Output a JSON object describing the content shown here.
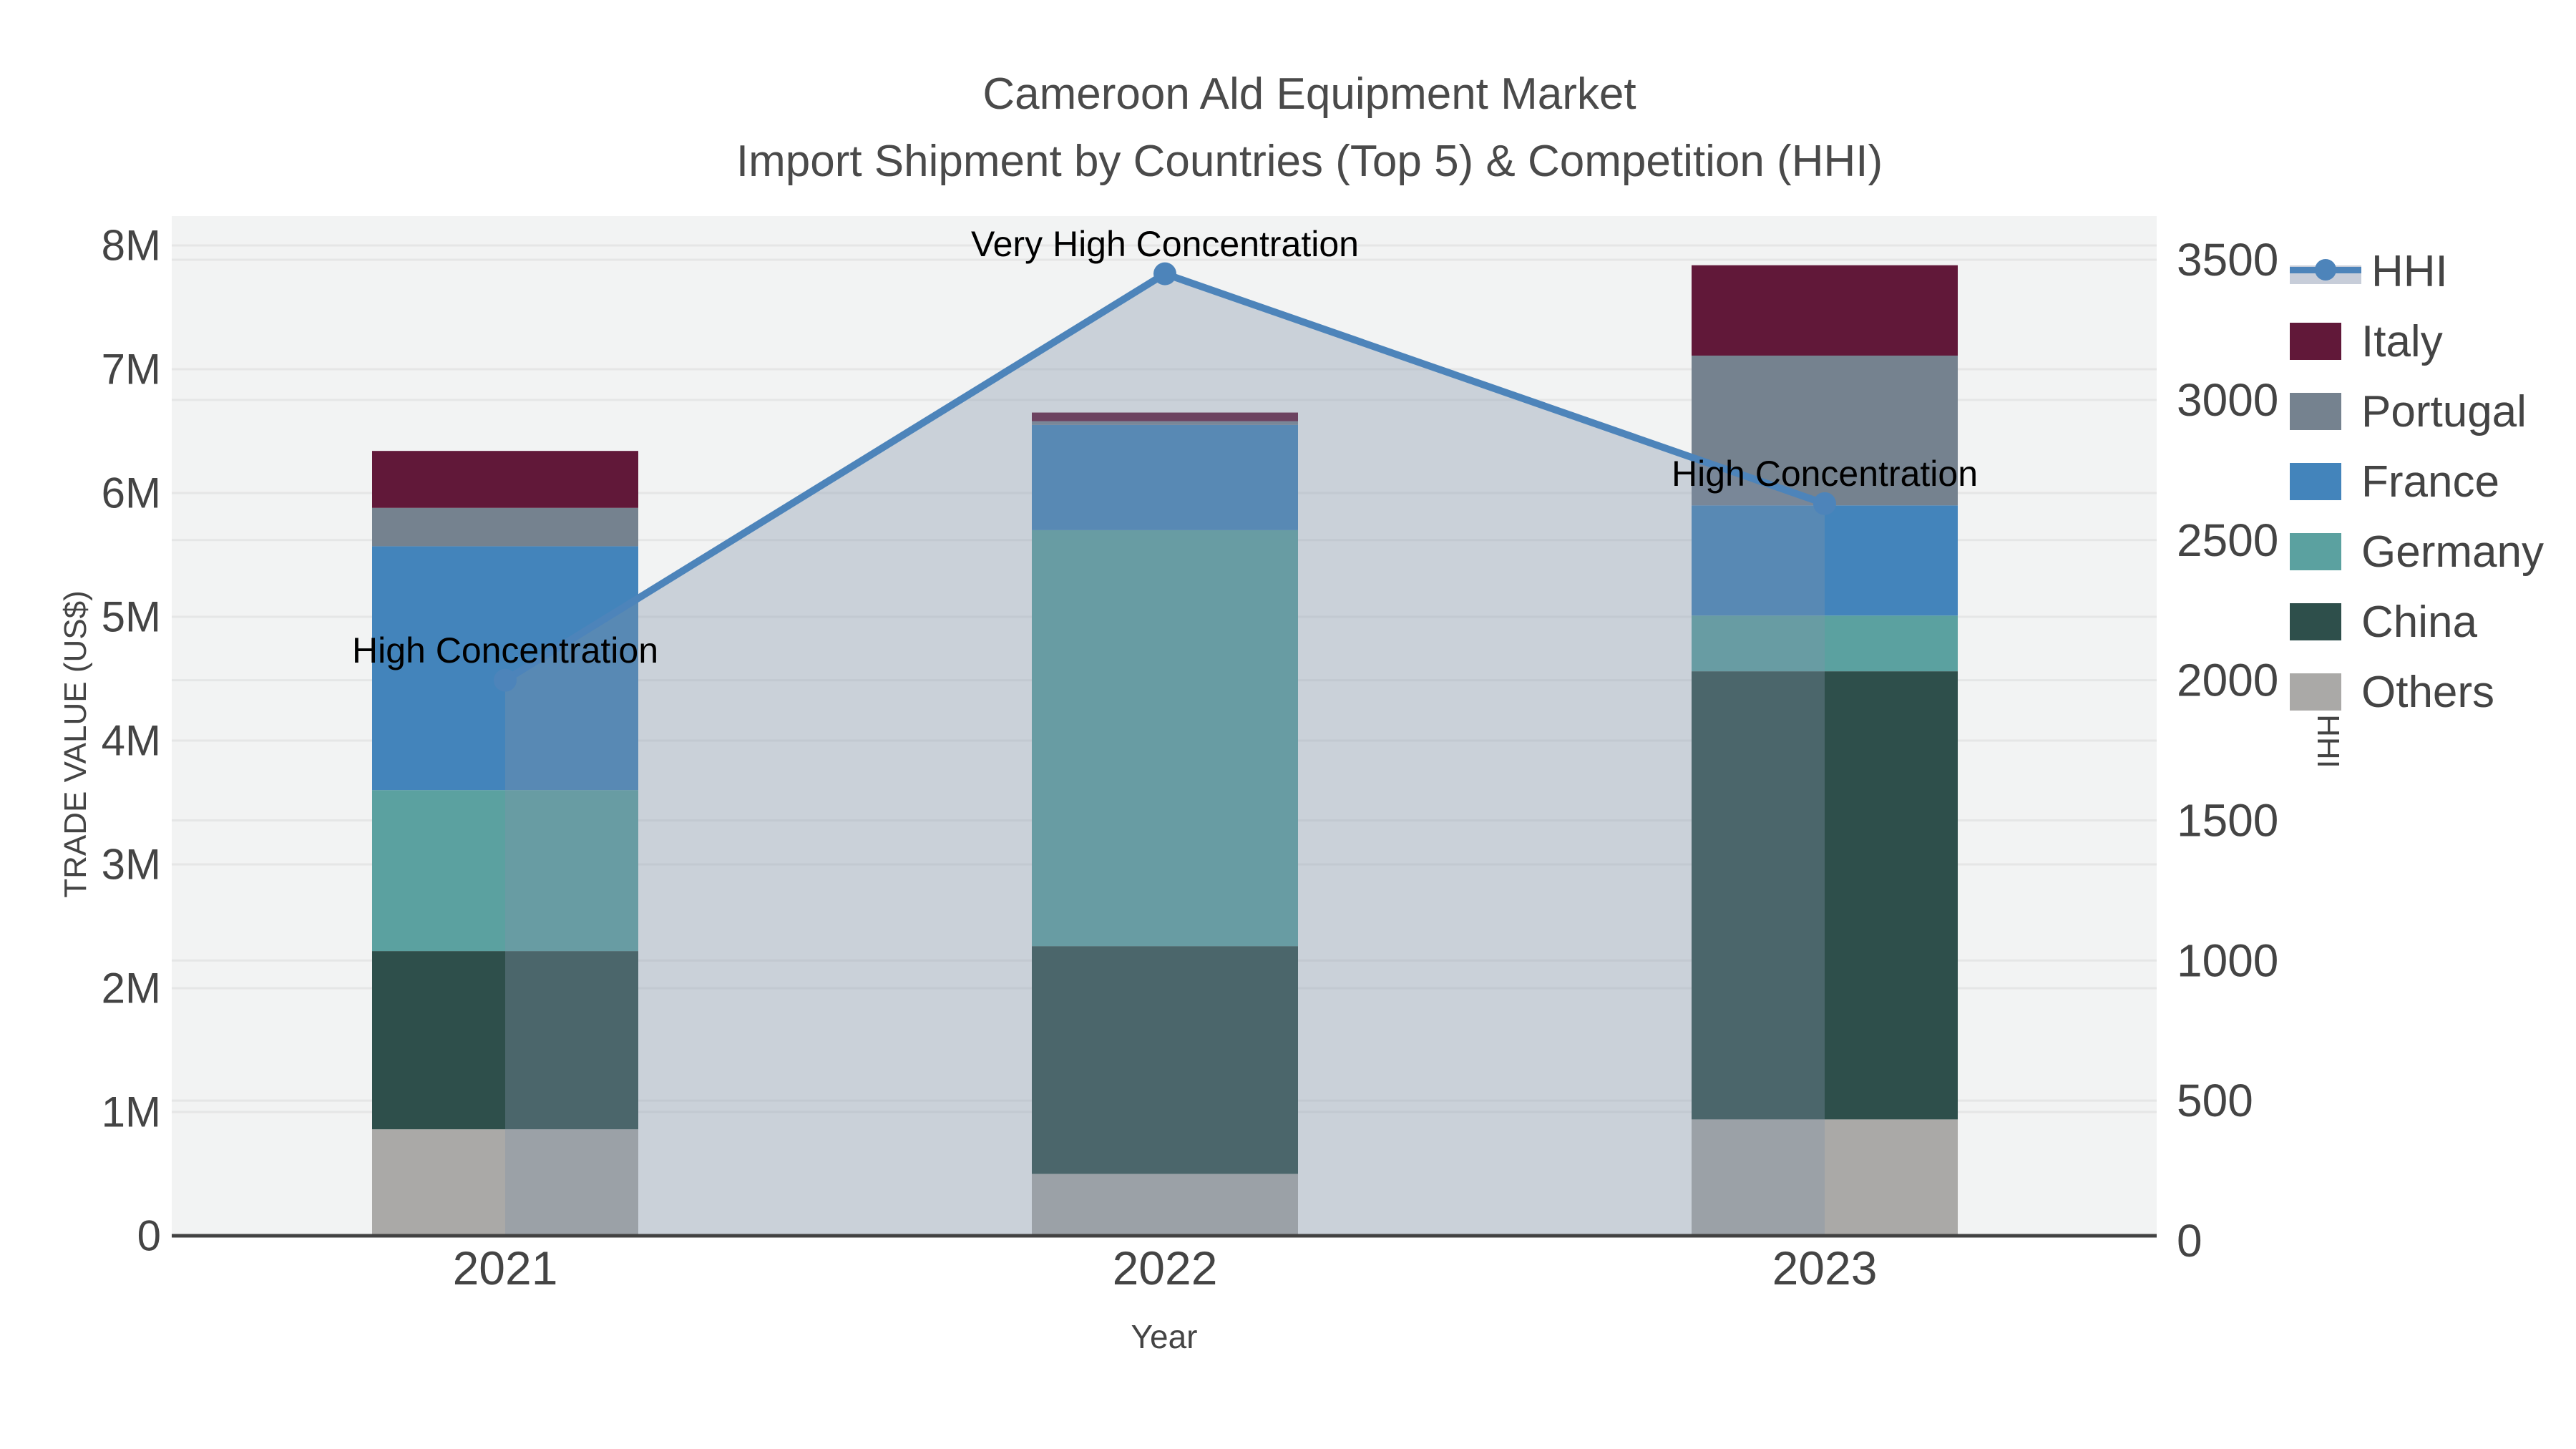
{
  "title": {
    "line1": "Cameroon Ald Equipment Market",
    "line2": "Import Shipment by Countries (Top 5) & Competition (HHI)"
  },
  "axes": {
    "left": {
      "title": "TRADE VALUE (US$)",
      "ticks": [
        "0",
        "1M",
        "2M",
        "3M",
        "4M",
        "5M",
        "6M",
        "7M",
        "8M"
      ]
    },
    "right": {
      "title": "HHI",
      "ticks": [
        "0",
        "500",
        "1000",
        "1500",
        "2000",
        "2500",
        "3000",
        "3500"
      ]
    },
    "x": {
      "title": "Year",
      "categories": [
        "2021",
        "2022",
        "2023"
      ]
    }
  },
  "legend": {
    "items": [
      {
        "label": "HHI",
        "type": "line"
      },
      {
        "label": "Italy",
        "type": "swatch"
      },
      {
        "label": "Portugal",
        "type": "swatch"
      },
      {
        "label": "France",
        "type": "swatch"
      },
      {
        "label": "Germany",
        "type": "swatch"
      },
      {
        "label": "China",
        "type": "swatch"
      },
      {
        "label": "Others",
        "type": "swatch"
      }
    ]
  },
  "annotations": [
    {
      "year": "2021",
      "text": "High Concentration"
    },
    {
      "year": "2022",
      "text": "Very High Concentration"
    },
    {
      "year": "2023",
      "text": "High Concentration"
    }
  ],
  "colors": {
    "series": {
      "Italy": "#611839",
      "Portugal": "#75828f",
      "France": "#4384bb",
      "Germany": "#5ba1a0",
      "China": "#2e4f4b",
      "Others": "#aaa9a7"
    },
    "hhi_line": "#4d84ba",
    "area_fill": "rgba(130,145,170,0.35)",
    "plot_bg": "#f2f3f3",
    "gridline": "#e5e6e6",
    "axis_line": "#424242",
    "text": "#444444"
  },
  "chart_data": {
    "type": "bar+line",
    "title": "Cameroon Ald Equipment Market — Import Shipment by Countries (Top 5) & Competition (HHI)",
    "categories": [
      "2021",
      "2022",
      "2023"
    ],
    "stacked": true,
    "unit": "million US$",
    "series": [
      {
        "name": "Others",
        "values_musd": [
          0.86,
          0.5,
          0.94
        ]
      },
      {
        "name": "China",
        "values_musd": [
          1.44,
          1.84,
          3.62
        ]
      },
      {
        "name": "Germany",
        "values_musd": [
          1.3,
          3.36,
          0.45
        ]
      },
      {
        "name": "France",
        "values_musd": [
          1.97,
          0.85,
          0.89
        ]
      },
      {
        "name": "Portugal",
        "values_musd": [
          0.31,
          0.03,
          1.21
        ]
      },
      {
        "name": "Italy",
        "values_musd": [
          0.46,
          0.07,
          0.73
        ]
      }
    ],
    "totals_musd": [
      6.34,
      6.65,
      7.84
    ],
    "line_series": {
      "name": "HHI",
      "axis": "right",
      "values": [
        2000,
        3450,
        2630
      ],
      "area_fill_to_zero": true
    },
    "xlabel": "Year",
    "ylabel": "TRADE VALUE (US$)",
    "y2label": "HHI",
    "ylim_usd": [
      0,
      8000000
    ],
    "y2lim": [
      0,
      3500
    ],
    "grid": true,
    "legend_position": "right"
  }
}
